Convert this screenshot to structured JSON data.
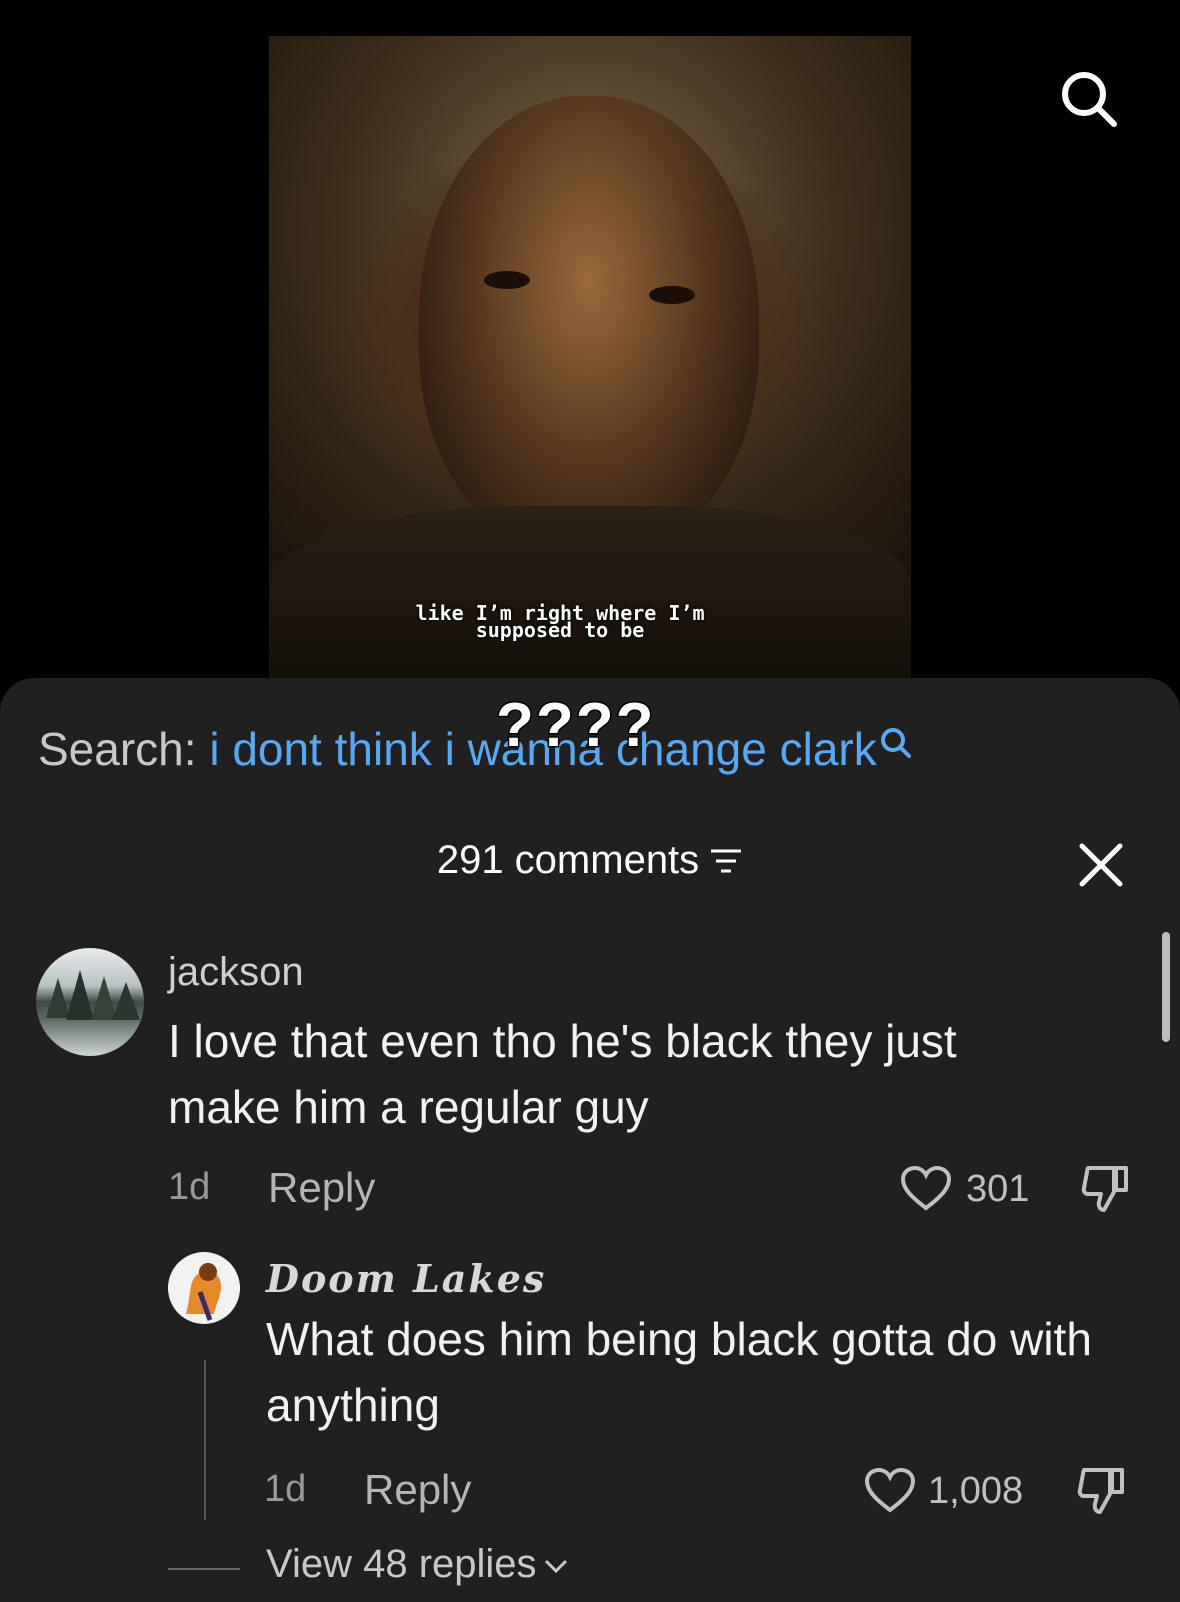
{
  "video": {
    "caption_line1": "like I’m right where I’m",
    "caption_line2": "supposed to be"
  },
  "search": {
    "label": "Search:",
    "query": "i dont think i wanna change clark",
    "overlay": "????"
  },
  "comments": {
    "count_label": "291 comments"
  },
  "comment1": {
    "username": "jackson",
    "text": "I love that even tho he's black they just make him a regular guy",
    "age": "1d",
    "reply_label": "Reply",
    "likes": "301"
  },
  "reply1": {
    "username": "Doom Lakes",
    "text": "What does him being black gotta do with anything",
    "age": "1d",
    "reply_label": "Reply",
    "likes": "1,008"
  },
  "view_replies": "View 48 replies",
  "colors": {
    "search_query": "#5aa7f2",
    "sheet_bg": "#202020"
  }
}
